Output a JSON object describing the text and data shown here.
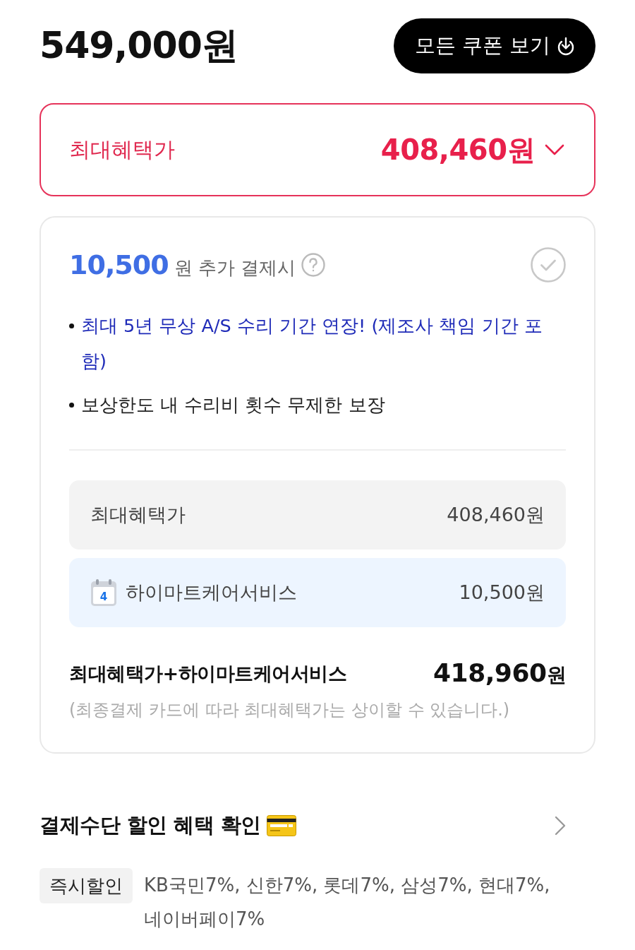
{
  "price": {
    "amount": "549,000원"
  },
  "coupon_button": {
    "label": "모든 쿠폰 보기"
  },
  "max_benefit": {
    "label": "최대혜택가",
    "price": "408,460원"
  },
  "care_offer": {
    "amount": "10,500",
    "text": "원 추가 결제시",
    "checked": false,
    "bullets": [
      {
        "text": "최대 5년 무상 A/S 수리 기간 연장! (제조사 책임 기간 포함)",
        "highlighted": true
      },
      {
        "text": "보상한도 내 수리비 횟수 무제한 보장",
        "highlighted": false
      }
    ],
    "breakdown": [
      {
        "kind": "plain",
        "label": "최대혜택가",
        "value": "408,460원"
      },
      {
        "kind": "service",
        "label": "하이마트케어서비스",
        "value": "10,500원",
        "calendar_day": "4"
      }
    ],
    "total": {
      "label": "최대혜택가+하이마트케어서비스",
      "amount": "418,960",
      "unit": "원"
    },
    "note": "(최종결제 카드에 따라 최대혜택가는 상이할 수 있습니다.)"
  },
  "payment": {
    "title": "결제수단 할인 혜택 확인",
    "tag": "즉시할인",
    "text": "KB국민7%, 신한7%, 롯데7%, 삼성7%, 현대7%, 네이버페이7%"
  }
}
